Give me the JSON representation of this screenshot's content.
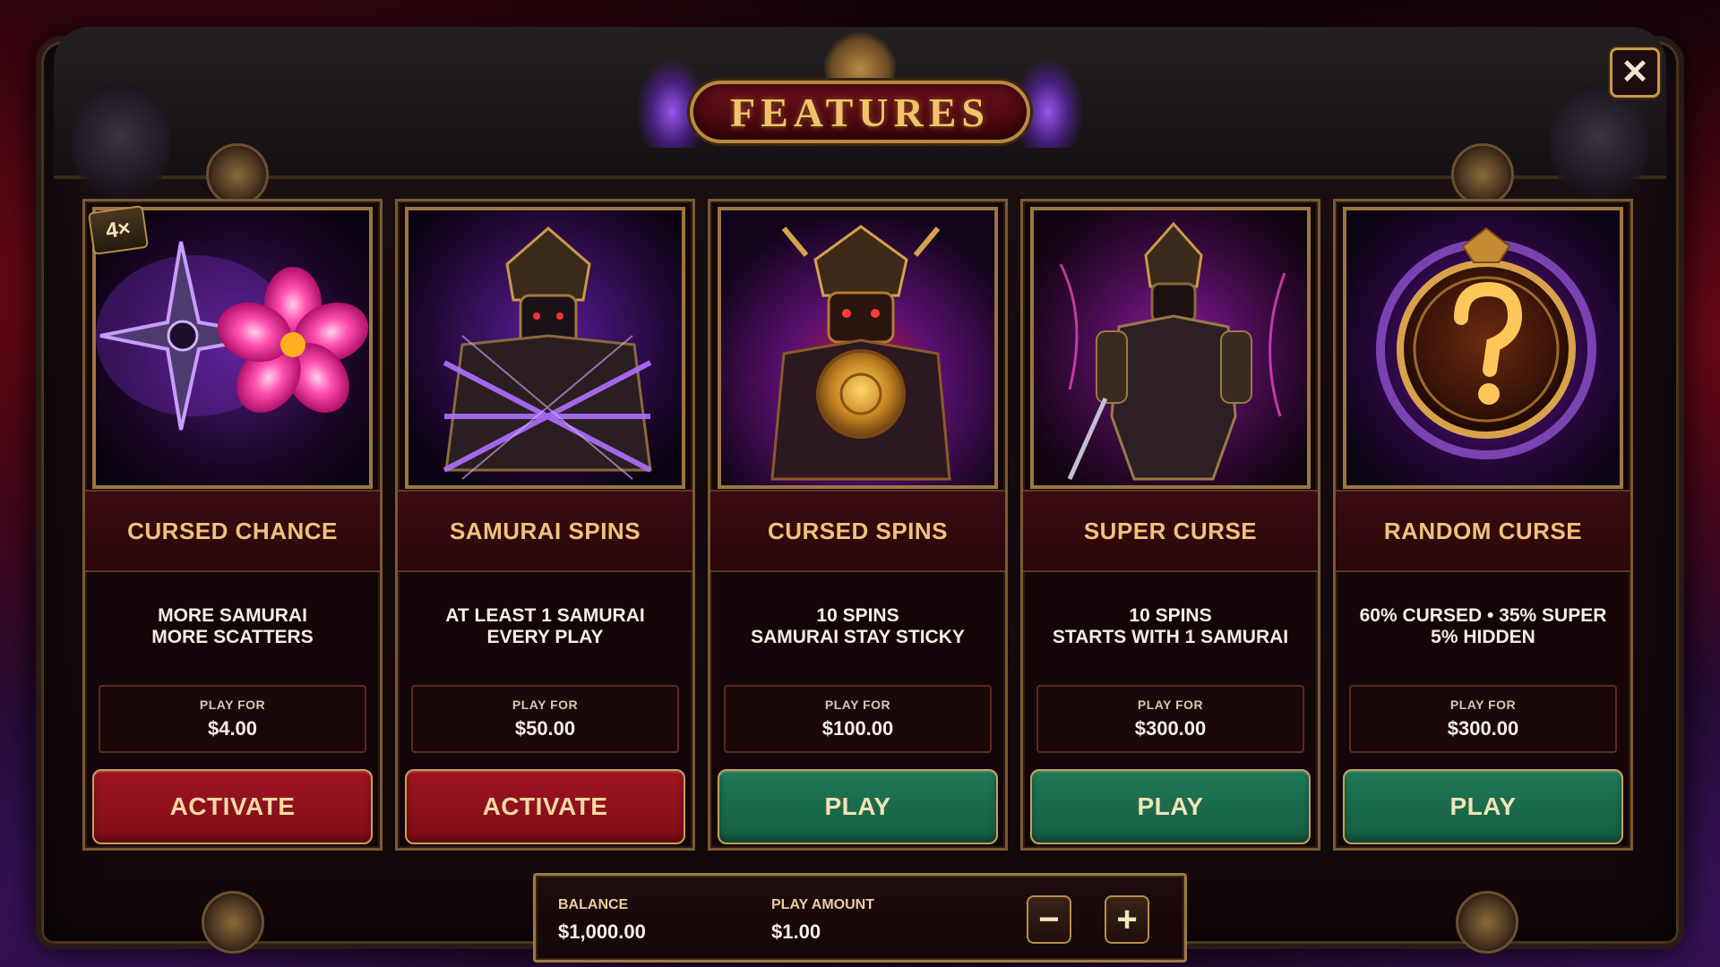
{
  "title": "FEATURES",
  "close_label": "✕",
  "cards": [
    {
      "title": "CURSED CHANCE",
      "badge": "4×",
      "desc_line1": "MORE SAMURAI",
      "desc_line2": "MORE SCATTERS",
      "play_for_label": "PLAY FOR",
      "price": "$4.00",
      "button": "ACTIVATE",
      "button_color": "#8f111c"
    },
    {
      "title": "SAMURAI SPINS",
      "desc_line1": "AT LEAST 1 SAMURAI",
      "desc_line2": "EVERY PLAY",
      "play_for_label": "PLAY FOR",
      "price": "$50.00",
      "button": "ACTIVATE",
      "button_color": "#8f111c"
    },
    {
      "title": "CURSED SPINS",
      "desc_line1": "10 SPINS",
      "desc_line2": "SAMURAI STAY STICKY",
      "play_for_label": "PLAY FOR",
      "price": "$100.00",
      "button": "PLAY",
      "button_color": "#196a4c"
    },
    {
      "title": "SUPER CURSE",
      "desc_line1": "10 SPINS",
      "desc_line2": "STARTS WITH 1 SAMURAI",
      "play_for_label": "PLAY FOR",
      "price": "$300.00",
      "button": "PLAY",
      "button_color": "#196a4c"
    },
    {
      "title": "RANDOM CURSE",
      "desc_line1": "60% CURSED • 35% SUPER",
      "desc_line2": "5% HIDDEN",
      "play_for_label": "PLAY FOR",
      "price": "$300.00",
      "button": "PLAY",
      "button_color": "#196a4c"
    }
  ],
  "bottom_bar": {
    "balance_label": "BALANCE",
    "balance_value": "$1,000.00",
    "play_amount_label": "PLAY AMOUNT",
    "play_amount_value": "$1.00",
    "minus_label": "−",
    "plus_label": "+"
  },
  "icons": {
    "card1": "shuriken-and-sakura-icon",
    "card2": "chained-samurai-icon",
    "card3": "samurai-with-golden-shield-icon",
    "card4": "armored-samurai-icon",
    "card5": "golden-question-mark-emblem-icon"
  }
}
